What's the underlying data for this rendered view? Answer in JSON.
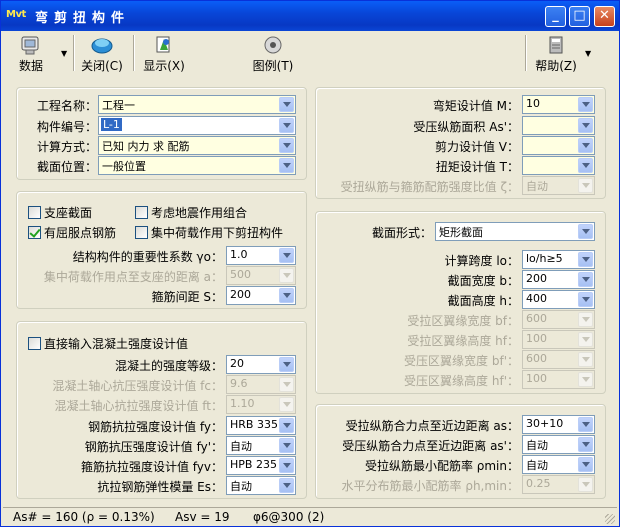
{
  "window": {
    "app_icon_text": "Mvt",
    "title": "弯剪扭构件",
    "controls": {
      "minimize": "_",
      "maximize": "□",
      "close": "✕"
    }
  },
  "toolbar": {
    "data": "数据",
    "close": "关闭(C)",
    "display": "显示(X)",
    "legend": "图例(T)",
    "help": "帮助(Z)"
  },
  "basic": {
    "project_name_label": "工程名称：",
    "project_name_value": "工程一",
    "member_id_label": "构件编号：",
    "member_id_value": "L-1",
    "calc_mode_label": "计算方式：",
    "calc_mode_value": "已知 内力 求 配筋",
    "section_pos_label": "截面位置：",
    "section_pos_value": "一般位置"
  },
  "options": {
    "support_section": "支座截面",
    "seismic_combo": "考虑地震作用组合",
    "yield_rebar": "有屈服点钢筋",
    "concentrated_load": "集中荷载作用下剪扭构件",
    "importance_label": "结构构件的重要性系数 γo：",
    "importance_value": "1.0",
    "load_distance_label": "集中荷载作用点至支座的距离 a：",
    "load_distance_value": "500",
    "stirrup_spacing_label": "箍筋间距 S：",
    "stirrup_spacing_value": "200"
  },
  "concrete": {
    "direct_input": "直接输入混凝土强度设计值",
    "grade_label": "混凝土的强度等级：",
    "grade_value": "20",
    "fc_label": "混凝土轴心抗压强度设计值 fc：",
    "fc_value": "9.6",
    "ft_label": "混凝土轴心抗拉强度设计值 ft：",
    "ft_value": "1.10",
    "fy_label": "钢筋抗拉强度设计值 fy：",
    "fy_value": "HRB 335",
    "fy2_label": "钢筋抗压强度设计值 fy'：",
    "fy2_value": "自动",
    "fyv_label": "箍筋抗拉强度设计值 fyv：",
    "fyv_value": "HPB 235",
    "es_label": "抗拉钢筋弹性模量 Es：",
    "es_value": "自动"
  },
  "forces": {
    "m_label": "弯矩设计值 M：",
    "m_value": "10",
    "as2_label": "受压纵筋面积 As'：",
    "as2_value": "",
    "v_label": "剪力设计值 V：",
    "v_value": "",
    "t_label": "扭矩设计值 T：",
    "t_value": "",
    "zeta_label": "受扭纵筋与箍筋配筋强度比值 ζ：",
    "zeta_value": "自动"
  },
  "section": {
    "shape_label": "截面形式：",
    "shape_value": "矩形截面",
    "span_label": "计算跨度 lo：",
    "span_value": "lo/h≥5",
    "width_label": "截面宽度 b：",
    "width_value": "200",
    "height_label": "截面高度 h：",
    "height_value": "400",
    "bf_label": "受拉区翼缘宽度 bf：",
    "bf_value": "600",
    "hf_label": "受拉区翼缘高度 hf：",
    "hf_value": "100",
    "bf2_label": "受压区翼缘宽度 bf'：",
    "bf2_value": "600",
    "hf2_label": "受压区翼缘高度 hf'：",
    "hf2_value": "100"
  },
  "reinf": {
    "as_label": "受拉纵筋合力点至近边距离 as：",
    "as_value": "30+10",
    "as2_label": "受压纵筋合力点至近边距离 as'：",
    "as2_value": "自动",
    "pmin_label": "受拉纵筋最小配筋率 ρmin：",
    "pmin_value": "自动",
    "phmin_label": "水平分布筋最小配筋率 ρh,min：",
    "phmin_value": "0.25"
  },
  "status": {
    "as_result": "As# = 160 (ρ = 0.13%)",
    "asv_result": "Asv = 19",
    "stirrup_result": "φ6@300 (2)"
  }
}
